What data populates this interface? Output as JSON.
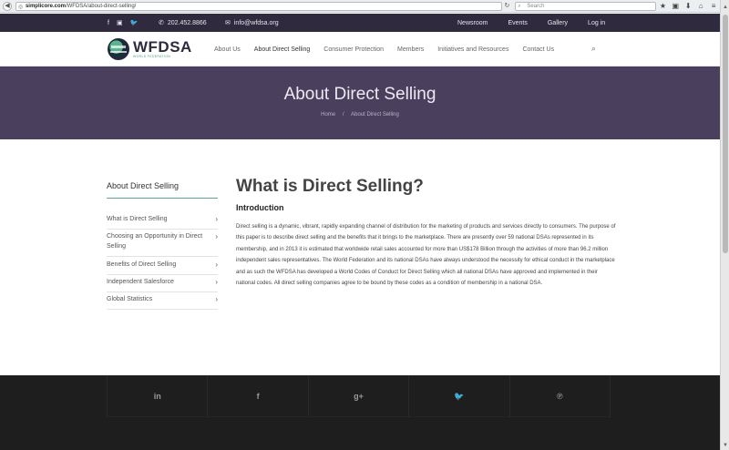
{
  "browser": {
    "url_prefix": "simplicore.com",
    "url_rest": "/WFDSA/about-direct-selling/",
    "search_placeholder": "Search",
    "back_glyph": "◀",
    "reload_glyph": "↻",
    "icons": [
      "star-icon",
      "clipboard-icon",
      "download-icon",
      "home-icon",
      "menu-icon"
    ]
  },
  "topbar": {
    "phone": "202.452.8866",
    "email": "info@wfdsa.org",
    "links": [
      "Newsroom",
      "Events",
      "Gallery",
      "Log in"
    ],
    "social": [
      "f",
      "▣",
      "🐦"
    ]
  },
  "header": {
    "logo_name": "WFDSA",
    "logo_sub": "WORLD FEDERATION",
    "nav": [
      "About Us",
      "About Direct Selling",
      "Consumer Protection",
      "Members",
      "Initiatives and Resources",
      "Contact Us"
    ]
  },
  "banner": {
    "title": "About Direct Selling",
    "crumb_home": "Home",
    "crumb_sep": "/",
    "crumb_current": "About Direct Selling"
  },
  "sidebar": {
    "title": "About Direct Selling",
    "items": [
      "What is Direct Selling",
      "Choosing an Opportunity in Direct Selling",
      "Benefits of Direct Selling",
      "Independent Salesforce",
      "Global Statistics"
    ]
  },
  "content": {
    "title": "What is Direct Selling?",
    "intro_heading": "Introduction",
    "paragraph": "Direct selling is a dynamic, vibrant, rapidly expanding channel of distribution for the marketing of products and services directly to consumers. The purpose of this paper is to describe direct selling and the benefits that it brings to the marketplace. There are presently over 59 national DSAs represented in its membership, and in 2013 it is estimated that worldwide retail sales accounted for more than US$178 Billion through the activities of more than 96.2 million independent sales representatives. The World Federation and its national DSAs have always understood the necessity for ethical conduct in the marketplace and as such the WFDSA has developed a World Codes of Conduct for Direct Selling which all national DSAs have approved and implemented in their national codes. All direct selling companies agree to be bound by these codes as a condition of membership in a national DSA."
  },
  "footer": {
    "social": [
      "in",
      "f",
      "g+",
      "🐦",
      "℗"
    ]
  },
  "colors": {
    "topstrip": "#2f2a3e",
    "banner": "#4b3f5e",
    "accent": "#5aa98a",
    "footer": "#1e1e1e"
  }
}
